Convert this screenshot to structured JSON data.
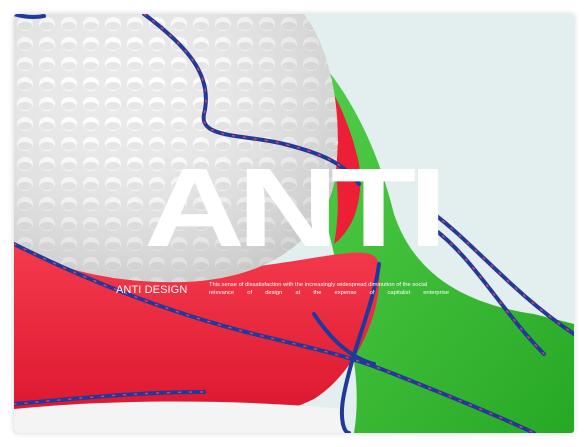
{
  "hero": {
    "headline": "ANTI",
    "caption_title": "ANTI DESIGN",
    "caption_line1": "This sense of dissatisfaction with the increasingly widespread diminution of the social",
    "caption_line2_words": [
      "relevance",
      "of",
      "design",
      "at",
      "the",
      "expense",
      "of",
      "capitalist",
      "enterprise"
    ],
    "tiny_label": "of"
  },
  "colors": {
    "background": "#e3eeee",
    "sphere": "#f2f2f2",
    "red": "#f0283c",
    "green": "#3ec43a",
    "rope": "#1f3a9a",
    "rope_dots": "#e8405a",
    "headline": "#ffffff"
  }
}
